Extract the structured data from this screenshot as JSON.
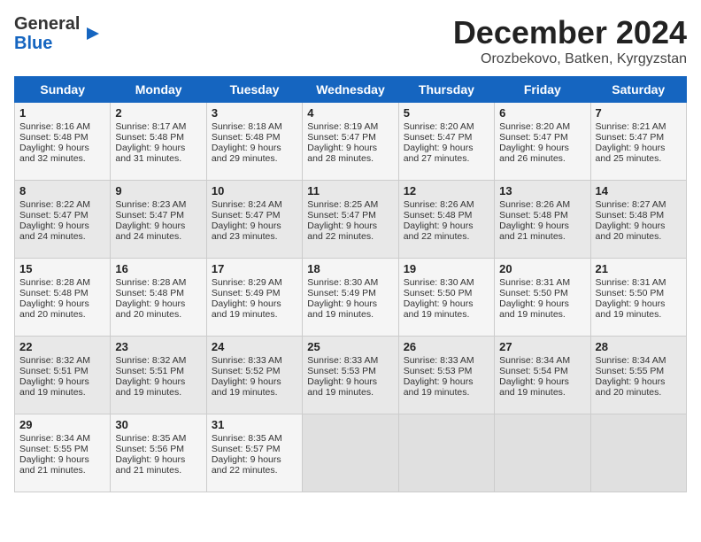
{
  "header": {
    "logo_line1": "General",
    "logo_line2": "Blue",
    "month_title": "December 2024",
    "location": "Orozbekovo, Batken, Kyrgyzstan"
  },
  "days_of_week": [
    "Sunday",
    "Monday",
    "Tuesday",
    "Wednesday",
    "Thursday",
    "Friday",
    "Saturday"
  ],
  "weeks": [
    [
      {
        "day": "1",
        "sunrise": "8:16 AM",
        "sunset": "5:48 PM",
        "daylight": "9 hours and 32 minutes."
      },
      {
        "day": "2",
        "sunrise": "8:17 AM",
        "sunset": "5:48 PM",
        "daylight": "9 hours and 31 minutes."
      },
      {
        "day": "3",
        "sunrise": "8:18 AM",
        "sunset": "5:48 PM",
        "daylight": "9 hours and 29 minutes."
      },
      {
        "day": "4",
        "sunrise": "8:19 AM",
        "sunset": "5:47 PM",
        "daylight": "9 hours and 28 minutes."
      },
      {
        "day": "5",
        "sunrise": "8:20 AM",
        "sunset": "5:47 PM",
        "daylight": "9 hours and 27 minutes."
      },
      {
        "day": "6",
        "sunrise": "8:20 AM",
        "sunset": "5:47 PM",
        "daylight": "9 hours and 26 minutes."
      },
      {
        "day": "7",
        "sunrise": "8:21 AM",
        "sunset": "5:47 PM",
        "daylight": "9 hours and 25 minutes."
      }
    ],
    [
      {
        "day": "8",
        "sunrise": "8:22 AM",
        "sunset": "5:47 PM",
        "daylight": "9 hours and 24 minutes."
      },
      {
        "day": "9",
        "sunrise": "8:23 AM",
        "sunset": "5:47 PM",
        "daylight": "9 hours and 24 minutes."
      },
      {
        "day": "10",
        "sunrise": "8:24 AM",
        "sunset": "5:47 PM",
        "daylight": "9 hours and 23 minutes."
      },
      {
        "day": "11",
        "sunrise": "8:25 AM",
        "sunset": "5:47 PM",
        "daylight": "9 hours and 22 minutes."
      },
      {
        "day": "12",
        "sunrise": "8:26 AM",
        "sunset": "5:48 PM",
        "daylight": "9 hours and 22 minutes."
      },
      {
        "day": "13",
        "sunrise": "8:26 AM",
        "sunset": "5:48 PM",
        "daylight": "9 hours and 21 minutes."
      },
      {
        "day": "14",
        "sunrise": "8:27 AM",
        "sunset": "5:48 PM",
        "daylight": "9 hours and 20 minutes."
      }
    ],
    [
      {
        "day": "15",
        "sunrise": "8:28 AM",
        "sunset": "5:48 PM",
        "daylight": "9 hours and 20 minutes."
      },
      {
        "day": "16",
        "sunrise": "8:28 AM",
        "sunset": "5:48 PM",
        "daylight": "9 hours and 20 minutes."
      },
      {
        "day": "17",
        "sunrise": "8:29 AM",
        "sunset": "5:49 PM",
        "daylight": "9 hours and 19 minutes."
      },
      {
        "day": "18",
        "sunrise": "8:30 AM",
        "sunset": "5:49 PM",
        "daylight": "9 hours and 19 minutes."
      },
      {
        "day": "19",
        "sunrise": "8:30 AM",
        "sunset": "5:50 PM",
        "daylight": "9 hours and 19 minutes."
      },
      {
        "day": "20",
        "sunrise": "8:31 AM",
        "sunset": "5:50 PM",
        "daylight": "9 hours and 19 minutes."
      },
      {
        "day": "21",
        "sunrise": "8:31 AM",
        "sunset": "5:50 PM",
        "daylight": "9 hours and 19 minutes."
      }
    ],
    [
      {
        "day": "22",
        "sunrise": "8:32 AM",
        "sunset": "5:51 PM",
        "daylight": "9 hours and 19 minutes."
      },
      {
        "day": "23",
        "sunrise": "8:32 AM",
        "sunset": "5:51 PM",
        "daylight": "9 hours and 19 minutes."
      },
      {
        "day": "24",
        "sunrise": "8:33 AM",
        "sunset": "5:52 PM",
        "daylight": "9 hours and 19 minutes."
      },
      {
        "day": "25",
        "sunrise": "8:33 AM",
        "sunset": "5:53 PM",
        "daylight": "9 hours and 19 minutes."
      },
      {
        "day": "26",
        "sunrise": "8:33 AM",
        "sunset": "5:53 PM",
        "daylight": "9 hours and 19 minutes."
      },
      {
        "day": "27",
        "sunrise": "8:34 AM",
        "sunset": "5:54 PM",
        "daylight": "9 hours and 19 minutes."
      },
      {
        "day": "28",
        "sunrise": "8:34 AM",
        "sunset": "5:55 PM",
        "daylight": "9 hours and 20 minutes."
      }
    ],
    [
      {
        "day": "29",
        "sunrise": "8:34 AM",
        "sunset": "5:55 PM",
        "daylight": "9 hours and 21 minutes."
      },
      {
        "day": "30",
        "sunrise": "8:35 AM",
        "sunset": "5:56 PM",
        "daylight": "9 hours and 21 minutes."
      },
      {
        "day": "31",
        "sunrise": "8:35 AM",
        "sunset": "5:57 PM",
        "daylight": "9 hours and 22 minutes."
      },
      null,
      null,
      null,
      null
    ]
  ],
  "labels": {
    "sunrise": "Sunrise:",
    "sunset": "Sunset:",
    "daylight": "Daylight:"
  }
}
